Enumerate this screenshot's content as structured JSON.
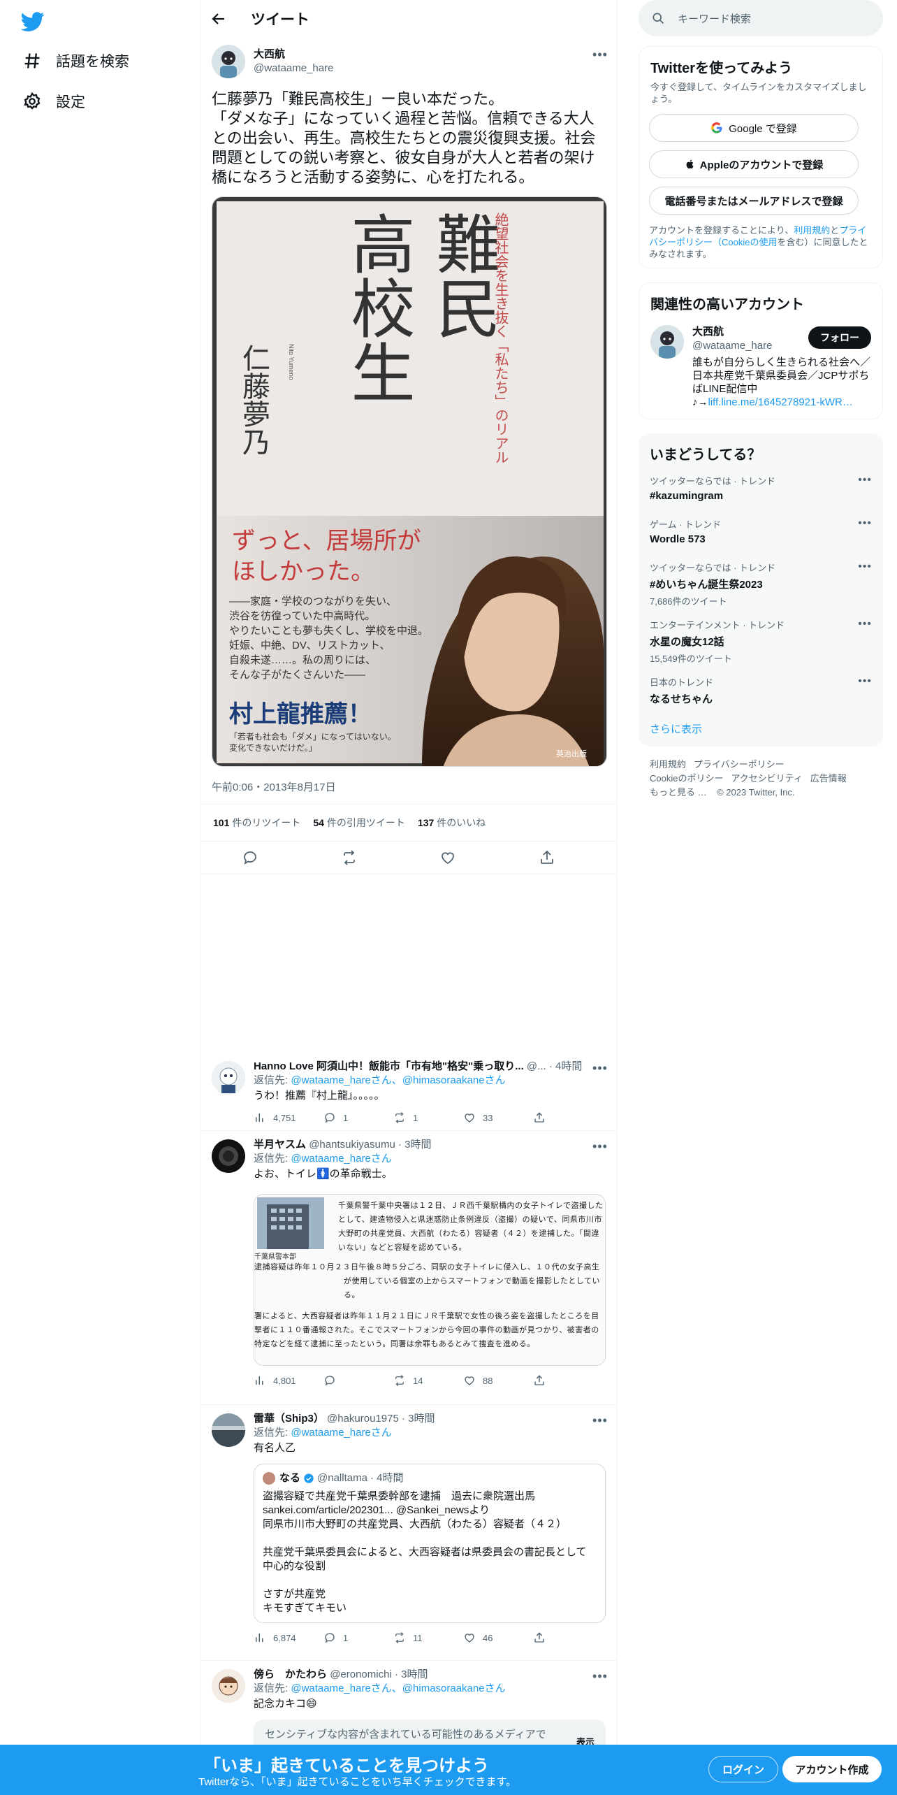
{
  "nav": {
    "explore_label": "話題を検索",
    "settings_label": "設定"
  },
  "header": {
    "title": "ツイート"
  },
  "tweet": {
    "author_name": "大西航",
    "author_handle": "@wataame_hare",
    "text": "仁藤夢乃「難民高校生」ー良い本だった。\n「ダメな子」になっていく過程と苦悩。信頼できる大人との出会い、再生。高校生たちとの震災復興支援。社会問題としての鋭い考察と、彼女自身が大人と若者の架け橋になろうと活動する姿勢に、心を打たれる。",
    "timestamp": "午前0:06・2013年8月17日",
    "retweets_count": "101",
    "retweets_label": "件のリツイート",
    "quotes_count": "54",
    "quotes_label": "件の引用ツイート",
    "likes_count": "137",
    "likes_label": "件のいいね",
    "book": {
      "title_a": "難民",
      "title_b": "高校生",
      "subtitle": "絶望社会を生き抜く「私たち」のリアル",
      "author": "仁藤夢乃",
      "author_romaji": "Nito Yumeno",
      "catch": "ずっと、居場所が\nほしかった。",
      "blurb": "——家庭・学校のつながりを失い、\n渋谷を彷徨っていた中高時代。\nやりたいことも夢も失くし、学校を中退。\n妊娠、中絶、DV、リストカット、\n自殺未遂……。私の周りには、\nそんな子がたくさんいた——",
      "recommend": "村上龍推薦！",
      "recommend_sub": "「若者も社会も「ダメ」になってはいない。\n変化できないだけだ。」",
      "publisher": "英治出版"
    }
  },
  "replies": [
    {
      "name": "Hanno Love 阿須山中！飯能市「市有地\"格安\"乗っ取り...",
      "handle": "@...",
      "time": "· 4時間",
      "reply_prefix": "返信先: ",
      "reply_to": "@wataame_hareさん、@himasoraakaneさん",
      "text": "うわ！推薦『村上龍』。。。。。",
      "views": "4,751",
      "replies": "1",
      "retweets": "1",
      "likes": "33"
    },
    {
      "name": "半月ヤスム",
      "handle": "@hantsukiyasumu",
      "time": "· 3時間",
      "reply_prefix": "返信先: ",
      "reply_to": "@wataame_hareさん",
      "text": "よお、トイレ🚺の革命戦士。",
      "article_caption": "千葉県警本部",
      "article_p1": "千葉県警千葉中央署は１２日、ＪＲ西千葉駅構内の女子トイレで盗撮したとして、建造物侵入と県迷惑防止条例違反（盗撮）の疑いで、同県市川市大野町の共産党員、大西航（わたる）容疑者（４２）を逮捕した。「間違いない」などと容疑を認めている。",
      "article_p2": "逮捕容疑は昨年１０月２３日午後８時５分ごろ、同駅の女子トイレに侵入し、１０代の女子高生が使用している個室の上からスマートフォンで動画を撮影したとしている。",
      "article_p3": "署によると、大西容疑者は昨年１１月２１日にＪＲ千葉駅で女性の後ろ姿を盗撮したところを目撃者に１１０番通報された。そこでスマートフォンから今回の事件の動画が見つかり、被害者の特定などを経て逮捕に至ったという。同署は余罪もあるとみて捜査を進める。",
      "views": "4,801",
      "replies": "",
      "retweets": "14",
      "likes": "88"
    },
    {
      "name": "雷華（Ship3）",
      "handle": "@hakurou1975",
      "time": "· 3時間",
      "reply_prefix": "返信先: ",
      "reply_to": "@wataame_hareさん",
      "text": "有名人乙",
      "quote_name": "なる",
      "quote_handle": "@nalltama",
      "quote_time": "· 4時間",
      "quote_text": "盗撮容疑で共産党千葉県委幹部を逮捕　過去に衆院選出馬\nsankei.com/article/202301... @Sankei_newsより\n同県市川市大野町の共産党員、大西航（わたる）容疑者（４２）\n\n共産党千葉県委員会によると、大西容疑者は県委員会の書記長として中心的な役割\n\nさすが共産党\nキモすぎてキモい",
      "views": "6,874",
      "replies": "1",
      "retweets": "11",
      "likes": "46"
    },
    {
      "name": "傍ら　かたわら",
      "handle": "@eronomichi",
      "time": "· 3時間",
      "reply_prefix": "返信先: ",
      "reply_to": "@wataame_hareさん、@himasoraakaneさん",
      "text": "記念カキコ😄",
      "sensitive_text": "センシティブな内容が含まれている可能性のあるメディアで",
      "sensitive_show": "表示"
    }
  ],
  "sidebar": {
    "search_placeholder": "キーワード検索",
    "signup_title": "Twitterを使ってみよう",
    "signup_sub": "今すぐ登録して、タイムラインをカスタマイズしましょう。",
    "google_btn": "Google で登録",
    "apple_btn": "Appleのアカウントで登録",
    "phone_btn": "電話番号またはメールアドレスで登録",
    "terms_pre": "アカウントを登録することにより、",
    "terms_link1": "利用規約",
    "terms_mid": "と",
    "terms_link2": "プライバシーポリシー（Cookieの使用",
    "terms_post": "を含む）に同意したとみなされます。",
    "related_title": "関連性の高いアカウント",
    "related_name": "大西航",
    "related_handle": "@wataame_hare",
    "follow_btn": "フォロー",
    "related_bio": "誰もが自分らしく生きられる社会へ／日本共産党千葉県委員会／JCPサポちばLINE配信中",
    "related_link_prefix": "♪→",
    "related_link": "liff.line.me/1645278921-kWR…",
    "trends_title": "いまどうしてる？",
    "trends": [
      {
        "category": "ツイッターならでは · トレンド",
        "title": "#kazumingram",
        "count": ""
      },
      {
        "category": "ゲーム · トレンド",
        "title": "Wordle 573",
        "count": ""
      },
      {
        "category": "ツイッターならでは · トレンド",
        "title": "#めいちゃん誕生祭2023",
        "count": "7,686件のツイート"
      },
      {
        "category": "エンターテインメント · トレンド",
        "title": "水星の魔女12話",
        "count": "15,549件のツイート"
      },
      {
        "category": "日本のトレンド",
        "title": "なるせちゃん",
        "count": ""
      }
    ],
    "show_more": "さらに表示",
    "footer_terms": "利用規約",
    "footer_privacy": "プライバシーポリシー",
    "footer_cookie": "Cookieのポリシー",
    "footer_access": "アクセシビリティ",
    "footer_ads": "広告情報",
    "footer_more": "もっと見る …",
    "footer_copy": "© 2023 Twitter, Inc."
  },
  "bottom_bar": {
    "headline": "「いま」起きていることを見つけよう",
    "sub": "Twitterなら、「いま」起きていることをいち早くチェックできます。",
    "login": "ログイン",
    "signup": "アカウント作成"
  },
  "colors": {
    "brand": "#1d9bf0",
    "text": "#0f1419",
    "muted": "#536471"
  }
}
